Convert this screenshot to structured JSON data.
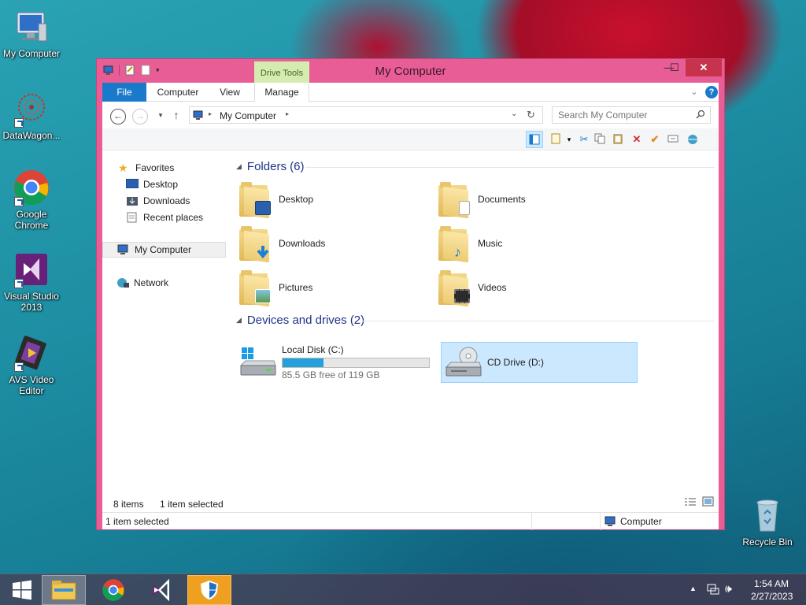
{
  "desktop": {
    "icons": [
      {
        "label": "My Computer"
      },
      {
        "label": "DataWagon..."
      },
      {
        "label": "Google Chrome"
      },
      {
        "label": "Visual Studio 2013"
      },
      {
        "label": "AVS Video Editor"
      },
      {
        "label": "Recycle Bin"
      }
    ]
  },
  "window": {
    "title": "My Computer",
    "contextual_tab_group": "Drive Tools",
    "tabs": [
      {
        "label": "File"
      },
      {
        "label": "Computer"
      },
      {
        "label": "View"
      },
      {
        "label": "Manage"
      }
    ],
    "controls": {
      "minimize": "—",
      "maximize": "☐",
      "close": "✕"
    },
    "address": {
      "path": "My Computer"
    },
    "search": {
      "placeholder": "Search My Computer"
    },
    "nav_pane": {
      "favorites": "Favorites",
      "favorites_items": [
        {
          "label": "Desktop"
        },
        {
          "label": "Downloads"
        },
        {
          "label": "Recent places"
        }
      ],
      "my_computer": "My Computer",
      "network": "Network"
    },
    "folders_group": {
      "title": "Folders (6)",
      "items": [
        {
          "label": "Desktop"
        },
        {
          "label": "Documents"
        },
        {
          "label": "Downloads"
        },
        {
          "label": "Music"
        },
        {
          "label": "Pictures"
        },
        {
          "label": "Videos"
        }
      ]
    },
    "devices_group": {
      "title": "Devices and drives (2)",
      "drives": [
        {
          "label": "Local Disk (C:)",
          "free": "85.5 GB free of 119 GB",
          "used_fraction": 0.28
        },
        {
          "label": "CD Drive (D:)"
        }
      ]
    },
    "status": {
      "items": "8 items",
      "selected": "1 item selected",
      "bottom_left": "1 item selected",
      "bottom_right": "Computer"
    }
  },
  "taskbar": {
    "clock_time": "1:54 AM",
    "clock_date": "2/27/2023"
  },
  "colors": {
    "window_frame": "#e85d95",
    "accent_file_tab": "#1979ca",
    "selection": "#cce8ff",
    "group_header": "#1e3287",
    "drive_bar": "#26a0da"
  }
}
